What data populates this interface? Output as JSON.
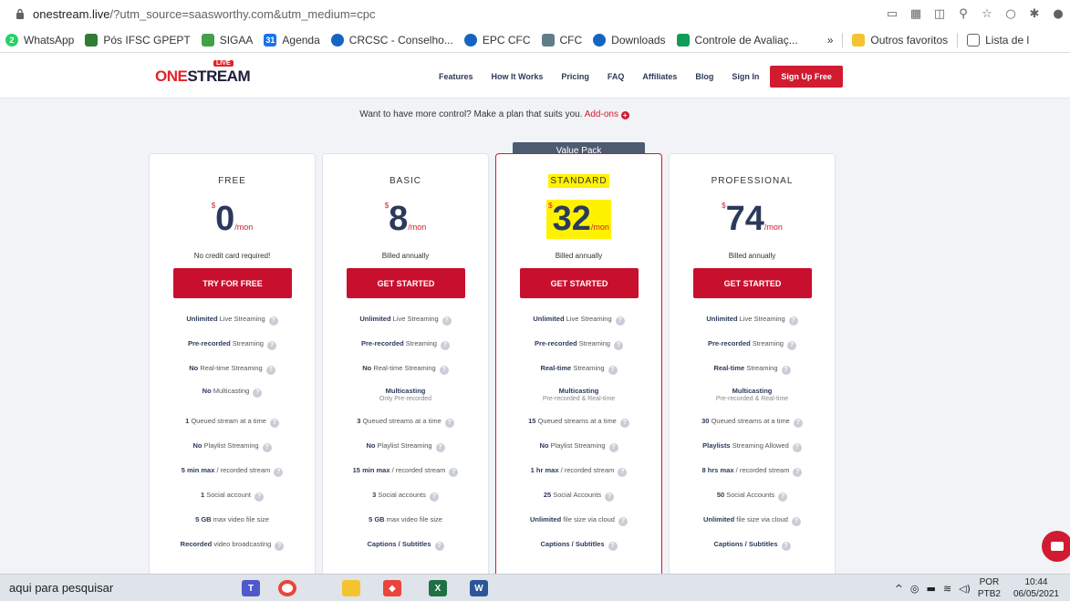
{
  "browser": {
    "url_host": "onestream.live",
    "url_path": "/?utm_source=saasworthy.com&utm_medium=cpc",
    "bookmarks": [
      "WhatsApp",
      "Pós IFSC GPEPT",
      "SIGAA",
      "Agenda",
      "CRCSC - Conselho...",
      "EPC CFC",
      "CFC",
      "Downloads",
      "Controle de Avaliaç...",
      "Outros favoritos",
      "Lista de l"
    ],
    "bookmarks_overflow": "»",
    "whatsapp_badge": "2",
    "agenda_badge": "31"
  },
  "header": {
    "logo_one": "ONE",
    "logo_stream": "STREAM",
    "logo_live": "LIVE",
    "nav": [
      "Features",
      "How It Works",
      "Pricing",
      "FAQ",
      "Affiliates",
      "Blog",
      "Sign In"
    ],
    "cta": "Sign Up Free"
  },
  "addons": {
    "text": "Want to have more control? Make a plan that suits you.",
    "link": "Add-ons",
    "icon": "+"
  },
  "value_pack": "Value Pack",
  "currency": "$",
  "per": "/mon",
  "help_icon": "?",
  "plans": [
    {
      "name": "FREE",
      "price": "0",
      "billing": "No credit card required!",
      "cta": "TRY FOR FREE",
      "f1b": "Unlimited",
      "f1": " Live Streaming",
      "f2b": "Pre-recorded",
      "f2": " Streaming",
      "f3b": "No",
      "f3": " Real-time Streaming",
      "f4b": "No",
      "f4": " Multicasting",
      "f4sub": "",
      "f5b": "1",
      "f5": " Queued stream at a time",
      "f6b": "No",
      "f6": " Playlist Streaming",
      "f7b": "5 min max",
      "f7": " / recorded stream",
      "f8b": "1",
      "f8": " Social account",
      "f9b": "5 GB",
      "f9": " max video file size",
      "f10b": "Recorded",
      "f10": " video broadcasting"
    },
    {
      "name": "BASIC",
      "price": "8",
      "billing": "Billed annually",
      "cta": "GET STARTED",
      "f1b": "Unlimited",
      "f1": " Live Streaming",
      "f2b": "Pre-recorded",
      "f2": " Streaming",
      "f3b": "No",
      "f3": " Real-time Streaming",
      "f4b": "Multicasting",
      "f4": "",
      "f4sub": "Only Pre-recorded",
      "f5b": "3",
      "f5": " Queued streams at a time",
      "f6b": "No",
      "f6": " Playlist Streaming",
      "f7b": "15 min max",
      "f7": " / recorded stream",
      "f8b": "3",
      "f8": " Social accounts",
      "f9b": "5 GB",
      "f9": " max video file size",
      "f10b": "Captions / Subtitles",
      "f10": ""
    },
    {
      "name": "STANDARD",
      "price": "32",
      "billing": "Billed annually",
      "cta": "GET STARTED",
      "f1b": "Unlimited",
      "f1": " Live Streaming",
      "f2b": "Pre-recorded",
      "f2": " Streaming",
      "f3b": "Real-time",
      "f3": " Streaming",
      "f4b": "Multicasting",
      "f4": "",
      "f4sub": "Pre-recorded & Real-time",
      "f5b": "15",
      "f5": " Queued streams at a time",
      "f6b": "No",
      "f6": " Playlist Streaming",
      "f7b": "1 hr max",
      "f7": " / recorded stream",
      "f8b": "25",
      "f8": " Social Accounts",
      "f9b": "Unlimited",
      "f9": " file size via cloud",
      "f10b": "Captions / Subtitles",
      "f10": ""
    },
    {
      "name": "PROFESSIONAL",
      "price": "74",
      "billing": "Billed annually",
      "cta": "GET STARTED",
      "f1b": "Unlimited",
      "f1": " Live Streaming",
      "f2b": "Pre-recorded",
      "f2": " Streaming",
      "f3b": "Real-time",
      "f3": " Streaming",
      "f4b": "Multicasting",
      "f4": "",
      "f4sub": "Pre-recorded & Real-time",
      "f5b": "30",
      "f5": " Queued streams at a time",
      "f6b": "Playlists",
      "f6": " Streaming Allowed",
      "f7b": "8 hrs max",
      "f7": " / recorded stream",
      "f8b": "50",
      "f8": " Social Accounts",
      "f9b": "Unlimited",
      "f9": " file size via cloud",
      "f10b": "Captions / Subtitles",
      "f10": ""
    }
  ],
  "taskbar": {
    "search": "aqui para pesquisar",
    "lang1": "POR",
    "lang2": "PTB2",
    "time": "10:44",
    "date": "06/05/2021"
  },
  "colors": {
    "brand_red": "#d01b31",
    "navy": "#2b3a5c",
    "badge": "#4d5a70",
    "highlight": "#fff200"
  }
}
